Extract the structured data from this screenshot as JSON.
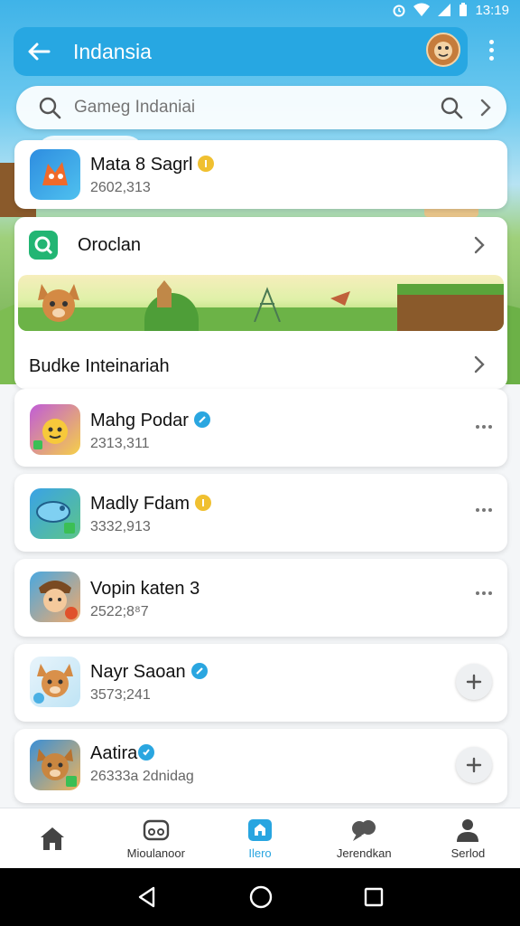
{
  "status_bar": {
    "time": "13:19"
  },
  "app_bar": {
    "title": "Indansia"
  },
  "search": {
    "placeholder": "Gameg Indaniai"
  },
  "featured": {
    "name": "Mata 8 Sagrl",
    "sub": "2602,313"
  },
  "collection": {
    "title": "Oroclan"
  },
  "section": {
    "title": "Budke Inteinariah"
  },
  "apps": [
    {
      "name": "Mahg Podar",
      "sub": "2313,311",
      "badge": "blue",
      "action": "more"
    },
    {
      "name": "Madly Fdam",
      "sub": "3332,913",
      "badge": "gold",
      "action": "more"
    },
    {
      "name": "Vopin katen 3",
      "sub": "2522;8⁸7",
      "badge": "none",
      "action": "more"
    },
    {
      "name": "Nayr Saoan",
      "sub": "3573;241",
      "badge": "blue",
      "action": "add"
    },
    {
      "name": "Aatira",
      "sub": "26333a 2dnidag",
      "badge": "blue",
      "action": "add"
    }
  ],
  "bottom_nav": [
    {
      "label": "Mioulanoor",
      "icon": "gamepad-icon",
      "active": false
    },
    {
      "label": "Ilero",
      "icon": "store-icon",
      "active": true
    },
    {
      "label": "Jerendkan",
      "icon": "community-icon",
      "active": false
    },
    {
      "label": "Serlod",
      "icon": "profile-icon",
      "active": false
    }
  ],
  "colors": {
    "accent": "#28a5e0",
    "app_bar": "#27a7e2",
    "gold_badge": "#f0c030"
  }
}
